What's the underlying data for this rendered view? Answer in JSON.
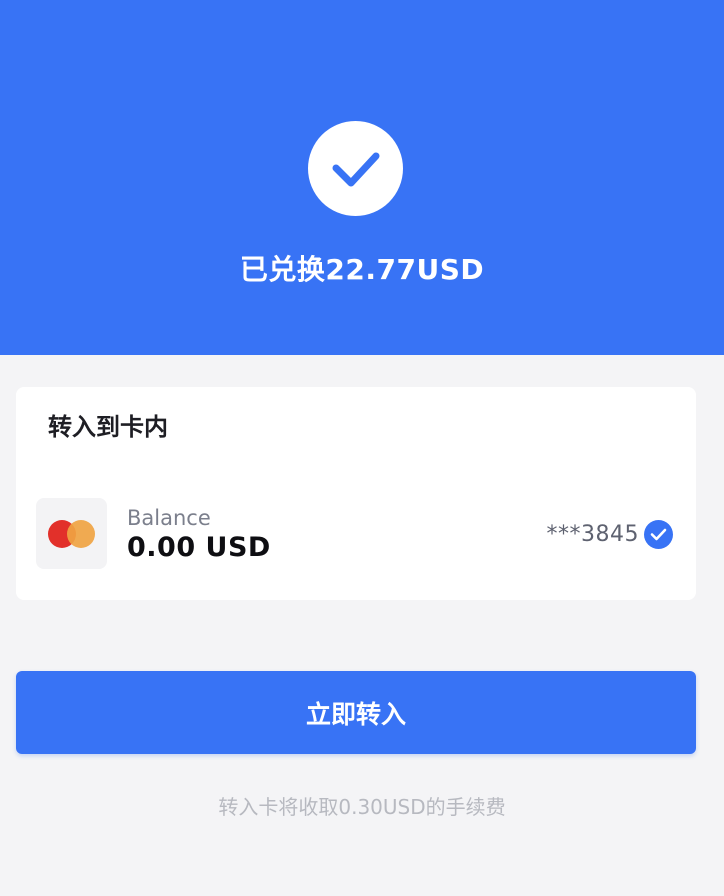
{
  "header": {
    "status_icon": "checkmark-icon",
    "title": "已兑换22.77USD",
    "background_color": "#3873f5"
  },
  "card_panel": {
    "title": "转入到卡内",
    "card": {
      "brand_icon": "mastercard-icon",
      "balance_label": "Balance",
      "balance_value": "0.00 USD",
      "card_number": "***3845",
      "selected_icon": "check-circle-icon",
      "selected": true
    }
  },
  "action": {
    "button_label": "立即转入",
    "fee_note": "转入卡将收取0.30USD的手续费"
  }
}
